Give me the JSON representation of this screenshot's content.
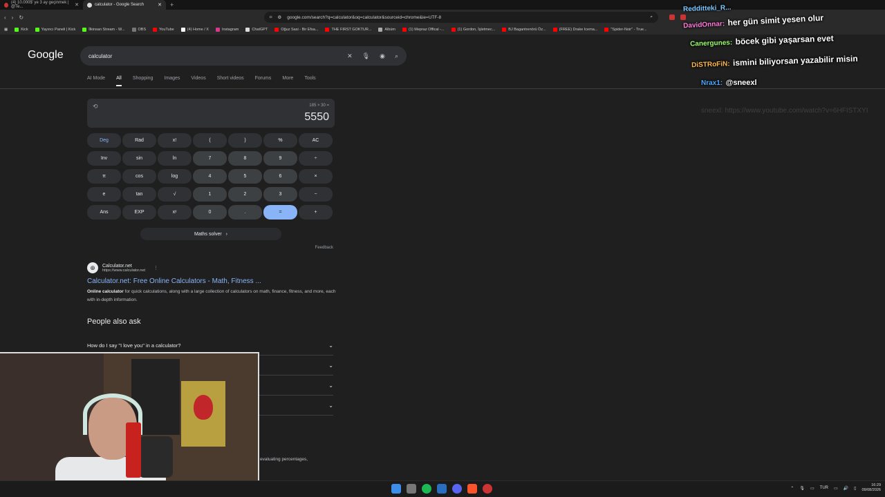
{
  "browser": {
    "tabs": [
      {
        "title": "(4) 10.000$' ye 3 ay geçinmek | @Te..."
      },
      {
        "title": "calculator - Google Search"
      }
    ],
    "address": "google.com/search?q=calculator&oq=calculator&sourceid=chrome&ie=UTF-8",
    "bookmarks": [
      "Kick",
      "Yayıncı Paneli | Kick",
      "İlkinsan Stream - W...",
      "OBS",
      "YouTube",
      "(4) Home / X",
      "Instagram",
      "ChatGPT",
      "Oğuz Sasi - Bir Efsa...",
      "THE FIRST GOKTUR...",
      "Albüm",
      "(1) Mepraz Offical -...",
      "(1) Gordon, İşletmec...",
      "BJ Bagantrenörü Öz...",
      "(FREE) Drake Icema...",
      "\"Spider-Noir\" - True..."
    ]
  },
  "google": {
    "logo": "Google",
    "query": "calculator",
    "tabs": [
      "AI Mode",
      "All",
      "Shopping",
      "Images",
      "Videos",
      "Short videos",
      "Forums",
      "More",
      "Tools"
    ]
  },
  "calculator": {
    "expression": "185 × 30 =",
    "result": "5550",
    "keys": [
      [
        "Deg",
        "Rad",
        "x!",
        "(",
        ")",
        "%",
        "AC"
      ],
      [
        "Inv",
        "sin",
        "ln",
        "7",
        "8",
        "9",
        "÷"
      ],
      [
        "π",
        "cos",
        "log",
        "4",
        "5",
        "6",
        "×"
      ],
      [
        "e",
        "tan",
        "√",
        "1",
        "2",
        "3",
        "−"
      ],
      [
        "Ans",
        "EXP",
        "xʸ",
        "0",
        ".",
        "=",
        "+"
      ]
    ],
    "solver_label": "Maths solver",
    "feedback": "Feedback"
  },
  "result": {
    "site_name": "Calculator.net",
    "site_url": "https://www.calculator.net",
    "title": "Calculator.net: Free Online Calculators - Math, Fitness ...",
    "snippet_bold": "Online calculator",
    "snippet": " for quick calculations, along with a large collection of calculators on math, finance, fitness, and more, each with in-depth information."
  },
  "paa": {
    "heading": "People also ask",
    "items": [
      "How do I say \"I love you\" in a calculator?",
      "",
      "",
      ""
    ],
    "tail": "evaluating percentages,"
  },
  "chat": [
    {
      "name": "Redditteki_R...",
      "text": "",
      "color": "#7ec8ff"
    },
    {
      "name": "DavidOnnar:",
      "text": "her gün simit yesen olur",
      "color": "#ff7ad9"
    },
    {
      "name": "Canergunes:",
      "text": "böcek gibi yaşarsan evet",
      "color": "#9cff6b"
    },
    {
      "name": "DiSTRoFiN:",
      "text": "ismini biliyorsan yazabilir misin",
      "color": "#ffb84d"
    },
    {
      "name": "Nrax1:",
      "text": "@sneexl",
      "color": "#4da6ff"
    }
  ],
  "faded_chat": "sneexl: https://www.youtube.com/watch?v=6HFISTXYI",
  "taskbar": {
    "lang": "TUR",
    "time": "16:29",
    "date": "09/08/2026"
  }
}
